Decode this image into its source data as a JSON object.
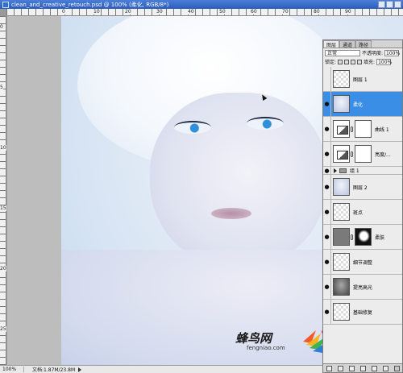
{
  "window": {
    "title": "clean_and_creative_retouch.psd @ 100% (柔化, RGB/8*)"
  },
  "rulers": {
    "top_labels": [
      "0",
      "10",
      "20",
      "30",
      "40",
      "50",
      "60",
      "70",
      "80",
      "90"
    ],
    "left_labels": [
      "0",
      "5",
      "10",
      "15",
      "20",
      "25"
    ]
  },
  "status": {
    "zoom": "100%",
    "doc_size": "文档:1.87M/23.8M"
  },
  "watermark": {
    "brand": "蜂鸟网",
    "domain": "fengniao.com"
  },
  "layers_panel": {
    "tabs": [
      "图层",
      "通道",
      "路径"
    ],
    "blend_mode": "正常",
    "opacity_label": "不透明度:",
    "opacity_value": "100%",
    "lock_label": "锁定:",
    "fill_label": "填充:",
    "fill_value": "100%",
    "layers": [
      {
        "name": "图层 1",
        "thumb": "trans",
        "visible": false,
        "selected": false,
        "mask": null
      },
      {
        "name": "柔化",
        "thumb": "face-t",
        "visible": true,
        "selected": true,
        "mask": null
      },
      {
        "name": "曲线 1",
        "thumb": "adj",
        "visible": true,
        "selected": false,
        "mask": "white"
      },
      {
        "name": "亮度/...",
        "thumb": "adj",
        "visible": true,
        "selected": false,
        "mask": "white"
      },
      {
        "name": "组 1",
        "group": true,
        "visible": true,
        "selected": false
      },
      {
        "name": "图层 2",
        "thumb": "face-t",
        "visible": true,
        "selected": false,
        "mask": null
      },
      {
        "name": "斑点",
        "thumb": "trans",
        "visible": true,
        "selected": false,
        "mask": null
      },
      {
        "name": "柔肤",
        "thumb": "gray",
        "visible": true,
        "selected": false,
        "mask": "bw"
      },
      {
        "name": "细节调整",
        "thumb": "trans",
        "visible": true,
        "selected": false,
        "mask": null
      },
      {
        "name": "提亮高光",
        "thumb": "dark",
        "visible": true,
        "selected": false,
        "mask": null
      },
      {
        "name": "基础修复",
        "thumb": "trans",
        "visible": true,
        "selected": false,
        "mask": null
      }
    ]
  },
  "colors": {
    "selection": "#3a8ee6",
    "titlebar": "#2b5cbf"
  }
}
